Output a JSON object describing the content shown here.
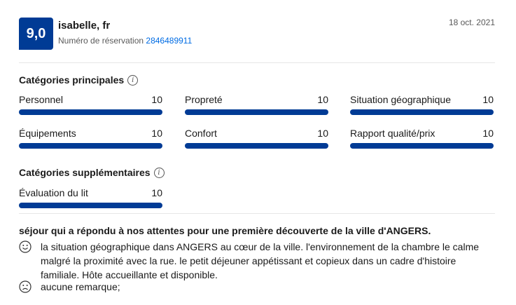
{
  "review": {
    "score": "9,0",
    "reviewer": "isabelle, fr",
    "booking_label": "Numéro de réservation",
    "booking_number": "2846489911",
    "date": "18 oct. 2021"
  },
  "main_categories": {
    "title": "Catégories principales",
    "items": [
      {
        "label": "Personnel",
        "score": "10"
      },
      {
        "label": "Propreté",
        "score": "10"
      },
      {
        "label": "Situation géographique",
        "score": "10"
      },
      {
        "label": "Équipements",
        "score": "10"
      },
      {
        "label": "Confort",
        "score": "10"
      },
      {
        "label": "Rapport qualité/prix",
        "score": "10"
      }
    ]
  },
  "extra_categories": {
    "title": "Catégories supplémentaires",
    "items": [
      {
        "label": "Évaluation du lit",
        "score": "10"
      }
    ]
  },
  "comment": {
    "title": "séjour qui a répondu à nos attentes pour une première découverte de la ville d'ANGERS.",
    "positive": "la situation géographique dans ANGERS au cœur de la ville. l'environnement de la chambre le calme malgré la proximité avec la rue. le petit déjeuner appétissant et copieux dans un cadre d'histoire familiale. Hôte accueillante et disponible.",
    "negative": "aucune remarque;"
  },
  "colors": {
    "accent": "#003b95",
    "link": "#006ce4"
  }
}
